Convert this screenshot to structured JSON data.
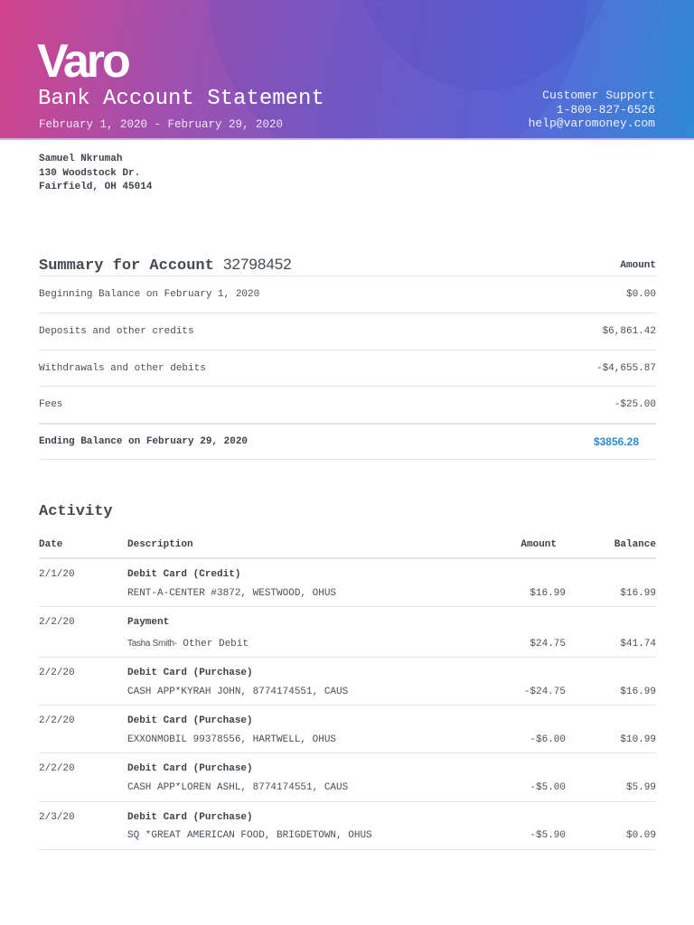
{
  "header": {
    "logo": "Varo",
    "title": "Bank Account Statement",
    "period": "February 1, 2020 - February 29, 2020",
    "support_label": "Customer Support",
    "phone": "1-800-827-6526",
    "email": "help@varomoney.com"
  },
  "customer": {
    "name": "Samuel Nkrumah",
    "street": "130 Woodstock Dr.",
    "city": "Fairfield, OH 45014"
  },
  "summary": {
    "title": "Summary for Account",
    "account": "32798452",
    "amount_header": "Amount",
    "rows": [
      {
        "label": "Beginning Balance on February 1, 2020",
        "value": "$0.00"
      },
      {
        "label": "Deposits and other credits",
        "value": "$6,861.42"
      },
      {
        "label": "Withdrawals and other debits",
        "value": "-$4,655.87"
      },
      {
        "label": "Fees",
        "value": "-$25.00"
      }
    ],
    "ending_label": "Ending Balance on February 29, 2020",
    "ending_value": "$3856.28"
  },
  "activity": {
    "title": "Activity",
    "headers": {
      "date": "Date",
      "description": "Description",
      "amount": "Amount",
      "balance": "Balance"
    },
    "rows": [
      {
        "date": "2/1/20",
        "type": "Debit Card (Credit)",
        "prefix": "",
        "detail": "RENT-A-CENTER #3872, WESTWOOD, OHUS",
        "amount": "$16.99",
        "balance": "$16.99"
      },
      {
        "date": "2/2/20",
        "type": "Payment",
        "prefix": "Tasha Smith-",
        "detail": "Other Debit",
        "amount": "$24.75",
        "balance": "$41.74"
      },
      {
        "date": "2/2/20",
        "type": "Debit Card (Purchase)",
        "prefix": "",
        "detail": "CASH APP*KYRAH JOHN, 8774174551, CAUS",
        "amount": "-$24.75",
        "balance": "$16.99"
      },
      {
        "date": "2/2/20",
        "type": "Debit Card (Purchase)",
        "prefix": "",
        "detail": "EXXONMOBIL 99378556, HARTWELL, OHUS",
        "amount": "-$6.00",
        "balance": "$10.99"
      },
      {
        "date": "2/2/20",
        "type": "Debit Card (Purchase)",
        "prefix": "",
        "detail": "CASH APP*LOREN ASHL, 8774174551, CAUS",
        "amount": "-$5.00",
        "balance": "$5.99"
      },
      {
        "date": "2/3/20",
        "type": "Debit Card (Purchase)",
        "prefix": "",
        "detail": "SQ *GREAT AMERICAN FOOD, BRIGDETOWN, OHUS",
        "amount": "-$5.90",
        "balance": "$0.09"
      }
    ]
  }
}
